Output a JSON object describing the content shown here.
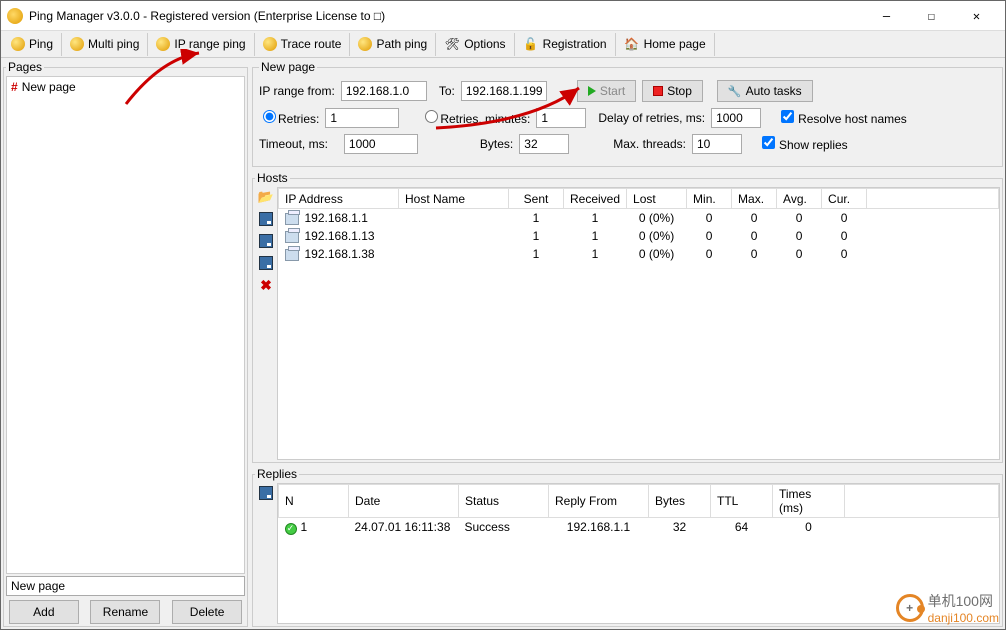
{
  "window": {
    "title": "Ping Manager v3.0.0 - Registered version (Enterprise License to □)"
  },
  "toolbar": {
    "ping": "Ping",
    "multi": "Multi ping",
    "range": "IP range ping",
    "trace": "Trace route",
    "path": "Path ping",
    "options": "Options",
    "reg": "Registration",
    "home": "Home page"
  },
  "pages": {
    "legend": "Pages",
    "item": "New page",
    "input": "New page",
    "add": "Add",
    "rename": "Rename",
    "delete": "Delete"
  },
  "newpage": {
    "legend": "New page",
    "ipfrom_lbl": "IP range from:",
    "ipfrom": "192.168.1.0",
    "to_lbl": "To:",
    "to": "192.168.1.199",
    "start": "Start",
    "stop": "Stop",
    "auto": "Auto tasks",
    "retries_lbl": "Retries:",
    "retries": "1",
    "retries_min_lbl": "Retries, minutes:",
    "retries_min": "1",
    "delay_lbl": "Delay of retries, ms:",
    "delay": "1000",
    "resolve": "Resolve host names",
    "timeout_lbl": "Timeout, ms:",
    "timeout": "1000",
    "bytes_lbl": "Bytes:",
    "bytes": "32",
    "maxthreads_lbl": "Max. threads:",
    "maxthreads": "10",
    "showreplies": "Show replies"
  },
  "hosts": {
    "legend": "Hosts",
    "cols": {
      "ip": "IP Address",
      "host": "Host Name",
      "sent": "Sent",
      "recv": "Received",
      "lost": "Lost",
      "min": "Min.",
      "max": "Max.",
      "avg": "Avg.",
      "cur": "Cur."
    },
    "rows": [
      {
        "ip": "192.168.1.1",
        "sent": "1",
        "recv": "1",
        "lost": "0 (0%)",
        "min": "0",
        "max": "0",
        "avg": "0",
        "cur": "0"
      },
      {
        "ip": "192.168.1.13",
        "sent": "1",
        "recv": "1",
        "lost": "0 (0%)",
        "min": "0",
        "max": "0",
        "avg": "0",
        "cur": "0"
      },
      {
        "ip": "192.168.1.38",
        "sent": "1",
        "recv": "1",
        "lost": "0 (0%)",
        "min": "0",
        "max": "0",
        "avg": "0",
        "cur": "0"
      }
    ]
  },
  "replies": {
    "legend": "Replies",
    "cols": {
      "n": "N",
      "date": "Date",
      "status": "Status",
      "from": "Reply From",
      "bytes": "Bytes",
      "ttl": "TTL",
      "times": "Times (ms)"
    },
    "rows": [
      {
        "n": "1",
        "date": "24.07.01 16:11:38",
        "status": "Success",
        "from": "192.168.1.1",
        "bytes": "32",
        "ttl": "64",
        "times": "0"
      }
    ]
  },
  "watermark": {
    "text": "单机100网",
    "domain": "danji100.co",
    "tld": "m"
  }
}
